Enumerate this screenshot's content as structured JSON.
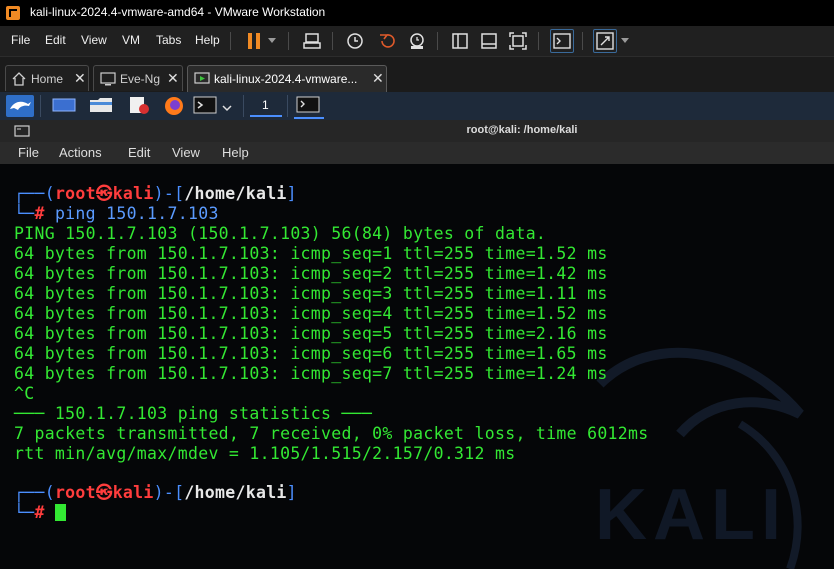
{
  "window": {
    "title": "kali-linux-2024.4-vmware-amd64 - VMware Workstation"
  },
  "menubar": {
    "items": [
      "File",
      "Edit",
      "View",
      "VM",
      "Tabs",
      "Help"
    ]
  },
  "tabs": [
    {
      "label": "Home",
      "icon": "home-icon"
    },
    {
      "label": "Eve-Ng",
      "icon": "vm-icon"
    },
    {
      "label": "kali-linux-2024.4-vmware...",
      "icon": "vm-running-icon",
      "active": true
    }
  ],
  "kali_panel": {
    "workspace": "1"
  },
  "terminal": {
    "title": "root@kali: /home/kali",
    "menu": [
      "File",
      "Actions",
      "Edit",
      "View",
      "Help"
    ],
    "prompt1": {
      "box_top": "┌──(",
      "user": "root",
      "skull": "㉿",
      "host": "kali",
      "close": ")-[",
      "path": "/home/kali",
      "end": "]",
      "box_bottom": "└─",
      "hash": "#",
      "command": "ping 150.1.7.103"
    },
    "output": [
      "PING 150.1.7.103 (150.1.7.103) 56(84) bytes of data.",
      "64 bytes from 150.1.7.103: icmp_seq=1 ttl=255 time=1.52 ms",
      "64 bytes from 150.1.7.103: icmp_seq=2 ttl=255 time=1.42 ms",
      "64 bytes from 150.1.7.103: icmp_seq=3 ttl=255 time=1.11 ms",
      "64 bytes from 150.1.7.103: icmp_seq=4 ttl=255 time=1.52 ms",
      "64 bytes from 150.1.7.103: icmp_seq=5 ttl=255 time=2.16 ms",
      "64 bytes from 150.1.7.103: icmp_seq=6 ttl=255 time=1.65 ms",
      "64 bytes from 150.1.7.103: icmp_seq=7 ttl=255 time=1.24 ms",
      "^C",
      "─── 150.1.7.103 ping statistics ───",
      "7 packets transmitted, 7 received, 0% packet loss, time 6012ms",
      "rtt min/avg/max/mdev = 1.105/1.515/2.157/0.312 ms"
    ],
    "prompt2": {
      "box_top": "┌──(",
      "user": "root",
      "skull": "㉿",
      "host": "kali",
      "close": ")-[",
      "path": "/home/kali",
      "end": "]",
      "box_bottom": "└─",
      "hash": "#"
    },
    "watermark": "KALI"
  },
  "colors": {
    "terminal_green": "#33e833",
    "prompt_blue": "#5b9bff",
    "prompt_red": "#ff3d3d",
    "vmware_orange": "#f08a24"
  }
}
